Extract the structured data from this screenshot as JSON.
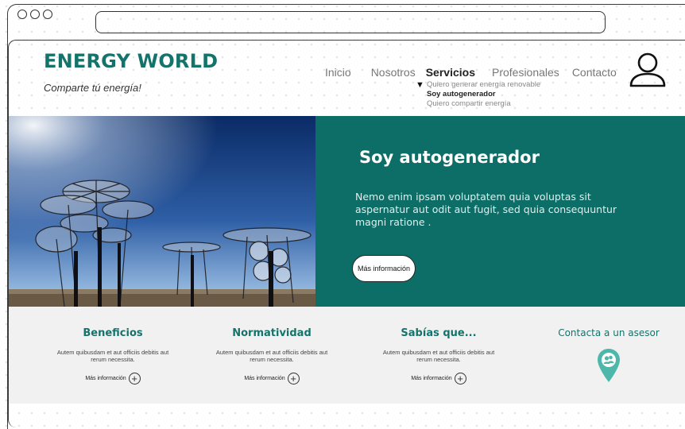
{
  "browser": {
    "window_controls": [
      "close",
      "minimize",
      "maximize"
    ],
    "address_bar_value": ""
  },
  "header": {
    "logo": "ENERGY WORLD",
    "tagline": "Comparte tú energía!",
    "nav": [
      {
        "label": "Inicio",
        "active": false
      },
      {
        "label": "Nosotros",
        "active": false
      },
      {
        "label": "Servicios",
        "active": true
      },
      {
        "label": "Profesionales",
        "active": false
      },
      {
        "label": "Contacto",
        "active": false
      }
    ],
    "submenu": [
      {
        "label": "Quiero generar energía renovable",
        "active": false
      },
      {
        "label": "Soy autogenerador",
        "active": true
      },
      {
        "label": "Quiero compartir energía",
        "active": false
      }
    ],
    "user_icon": "user-icon"
  },
  "hero": {
    "title": "Soy autogenerador",
    "text": "Nemo enim ipsam voluptatem quia voluptas sit aspernatur aut odit aut fugit, sed quia consequuntur magni  ratione .",
    "button": "Más información",
    "image_icon": "solar-dishes-photo"
  },
  "cards": [
    {
      "title": "Beneficios",
      "text": "Autem quibusdam et aut officiis debitis aut rerum necessita.",
      "link": "Más información"
    },
    {
      "title": "Normatividad",
      "text": "Autem quibusdam et aut officiis debitis aut rerum necessita.",
      "link": "Más información"
    },
    {
      "title": "Sabías que...",
      "text": "Autem quibusdam et aut officiis debitis aut rerum necessita.",
      "link": "Más información"
    }
  ],
  "contact": {
    "title": "Contacta a un asesor",
    "icon": "advisor-location-pin-icon"
  },
  "colors": {
    "brand": "#14736b",
    "hero_panel": "#0d6e67",
    "info_background": "#f1f1f1",
    "pin": "#4db8a9"
  }
}
